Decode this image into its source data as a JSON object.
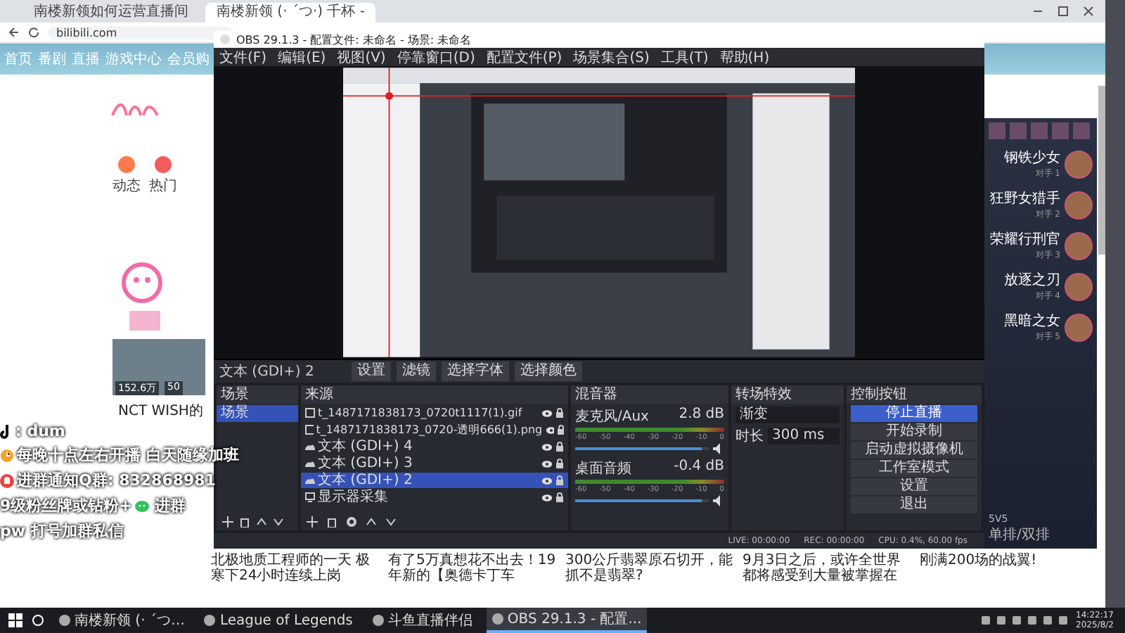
{
  "browser": {
    "tabs": [
      {
        "label": "南楼新领如何运营直播间",
        "selected": false
      },
      {
        "label": "南楼新领 (· ´つ·) 千杯 -",
        "selected": true
      }
    ],
    "address": "bilibili.com",
    "nav": [
      "首页",
      "番剧",
      "直播",
      "游戏中心",
      "会员购"
    ],
    "side_links": [
      "动态",
      "热门"
    ],
    "video_title": "NCT WISH的",
    "video_stats": [
      "152.6万",
      "50"
    ],
    "headlines": [
      "北极地质工程师的一天 极寒下24小时连续上岗",
      "有了5万真想花不出去！19年新的【奥德卡丁车",
      "300公斤翡翠原石切开，能抓不是翡翠?",
      "9月3日之后，或许全世界都将感受到大量被掌握在",
      "刚满200场的战翼!"
    ]
  },
  "obs": {
    "title": "OBS 29.1.3 - 配置文件: 未命名 - 场景: 未命名",
    "menu": [
      "文件(F)",
      "编辑(E)",
      "视图(V)",
      "停靠窗口(D)",
      "配置文件(P)",
      "场景集合(S)",
      "工具(T)",
      "帮助(H)"
    ],
    "toolbar": {
      "source": "文本 (GDI+) 2",
      "buttons": [
        "设置",
        "滤镜",
        "选择字体",
        "选择颜色"
      ]
    },
    "scenes": {
      "title": "场景",
      "items": [
        {
          "label": "场景",
          "selected": true
        }
      ]
    },
    "sources": {
      "title": "来源",
      "items": [
        {
          "kind": "image",
          "label": "t_1487171838173_0720t1117(1).gif",
          "selected": false
        },
        {
          "kind": "image",
          "label": "t_1487171838173_0720-透明666(1).png",
          "selected": false
        },
        {
          "kind": "text",
          "label": "文本 (GDI+) 4",
          "selected": false
        },
        {
          "kind": "text",
          "label": "文本 (GDI+) 3",
          "selected": false
        },
        {
          "kind": "text",
          "label": "文本 (GDI+) 2",
          "selected": true
        },
        {
          "kind": "monitor",
          "label": "显示器采集",
          "selected": false
        }
      ]
    },
    "mixer": {
      "title": "混音器",
      "channels": [
        {
          "name": "麦克风/Aux",
          "reading": "2.8 dB",
          "level": 0.95,
          "scale": [
            "-60",
            "-50",
            "-40",
            "-30",
            "-20",
            "-10",
            "0"
          ]
        },
        {
          "name": "桌面音频",
          "reading": "-0.4 dB",
          "level": 0.95,
          "scale": [
            "-60",
            "-50",
            "-40",
            "-30",
            "-20",
            "-10",
            "0"
          ]
        }
      ]
    },
    "transitions": {
      "title": "转场特效",
      "type": "渐变",
      "duration_label": "时长",
      "duration": "300 ms"
    },
    "controls": {
      "title": "控制按钮",
      "buttons": [
        {
          "label": "停止直播",
          "selected": true
        },
        {
          "label": "开始录制",
          "selected": false
        },
        {
          "label": "启动虚拟摄像机",
          "selected": false
        },
        {
          "label": "工作室模式",
          "selected": false
        },
        {
          "label": "设置",
          "selected": false
        },
        {
          "label": "退出",
          "selected": false
        }
      ]
    },
    "status": [
      "LIVE: 00:00:00",
      "REC: 00:00:00",
      "CPU: 0.4%, 60.00 fps"
    ]
  },
  "overlay": {
    "lines": [
      {
        "kind": "tiktok",
        "parts": [
          ": dum"
        ]
      },
      {
        "kind": "clock",
        "parts": [
          "每晚十点左右开播  白天随缘加班"
        ]
      },
      {
        "kind": "bell",
        "parts": [
          "进群通知Q群: 832868981"
        ]
      },
      {
        "kind": "wechat",
        "parts": [
          "9级粉丝牌或钻粉+",
          "进群"
        ]
      },
      {
        "kind": "plain",
        "parts": [
          "pw 打号加群私信"
        ]
      }
    ]
  },
  "game": {
    "champions": [
      {
        "name": "钢铁少女",
        "label": "对手 1"
      },
      {
        "name": "狂野女猎手",
        "label": "对手 2"
      },
      {
        "name": "荣耀行刑官",
        "label": "对手 3"
      },
      {
        "name": "放逐之刃",
        "label": "对手 4"
      },
      {
        "name": "黑暗之女",
        "label": "对手 5"
      }
    ],
    "mode": "5V5",
    "queue": "单排/双排"
  },
  "taskbar": {
    "items": [
      {
        "label": "南楼新领 (· ´つ…",
        "selected": false
      },
      {
        "label": "League of Legends",
        "selected": false
      },
      {
        "label": "斗鱼直播伴侣",
        "selected": false
      },
      {
        "label": "OBS 29.1.3 - 配置...",
        "selected": true
      }
    ],
    "time": "14:22:17",
    "date": "2025/8/2"
  }
}
